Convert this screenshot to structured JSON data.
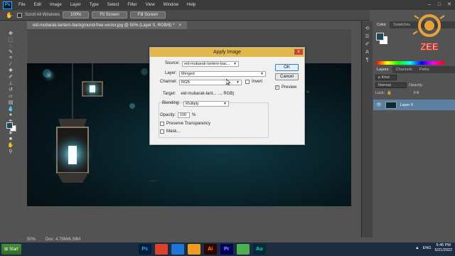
{
  "menubar": {
    "app_badge": "Ps",
    "items": [
      "File",
      "Edit",
      "Image",
      "Layer",
      "Type",
      "Select",
      "Filter",
      "View",
      "Window",
      "Help"
    ]
  },
  "options": {
    "scroll_all_label": "Scroll All Windows",
    "zoom_100": "100%",
    "fit_screen": "Fit Screen",
    "fill_screen": "Fill Screen"
  },
  "document": {
    "tab_title": "eid-mubarak-lantern-background-free-vector.jpg @ 50% (Layer 0, RGB/8) *",
    "zoom": "50%",
    "doc_size": "Doc: 4.79M/6.39M"
  },
  "dialog": {
    "title": "Apply Image",
    "source_label": "Source:",
    "source_value": "eid-mubarak-lantern-bac...",
    "layer_label": "Layer:",
    "layer_value": "Merged",
    "channel_label": "Channel:",
    "channel_value": "RGB",
    "invert_label": "Invert",
    "target_label": "Target:",
    "target_value": "eid-mubarak-lant... ..., RGB)",
    "blending_label": "Blending:",
    "blending_value": "Multiply",
    "opacity_label": "Opacity:",
    "opacity_value": "100",
    "opacity_unit": "%",
    "preserve_label": "Preserve Transparency",
    "mask_label": "Mask...",
    "ok_label": "OK",
    "cancel_label": "Cancel",
    "preview_label": "Preview",
    "preview_checked": "✓",
    "close_label": "x"
  },
  "right_panels": {
    "color_tabs": [
      "Color",
      "Swatches"
    ],
    "layers_tabs": [
      "Layers",
      "Channels",
      "Paths"
    ],
    "kind_filter": "ρ Kind",
    "blend_mode": "Normal",
    "opacity_label": "Opacity:",
    "lock_label": "Lock:",
    "fill_label": "Fill:",
    "layer_name": "Layer 0"
  },
  "logo": {
    "text": "ZEE"
  },
  "taskbar": {
    "start_label": "Start",
    "apps": [
      {
        "label": "Ps",
        "color": "#31a8ff",
        "bg": "#001e36"
      },
      {
        "label": "",
        "color": "#fff",
        "bg": "#d9442f"
      },
      {
        "label": "",
        "color": "#fff",
        "bg": "#1f74d6"
      },
      {
        "label": "",
        "color": "#fff",
        "bg": "#f29b21"
      },
      {
        "label": "Ai",
        "color": "#ff9a00",
        "bg": "#330000"
      },
      {
        "label": "Pr",
        "color": "#9999ff",
        "bg": "#00005b"
      },
      {
        "label": "",
        "color": "#fff",
        "bg": "#4caf50"
      },
      {
        "label": "Au",
        "color": "#00e4bb",
        "bg": "#00293b"
      }
    ],
    "lang": "ENG",
    "time": "6:46 PM",
    "date": "5/21/2022"
  }
}
